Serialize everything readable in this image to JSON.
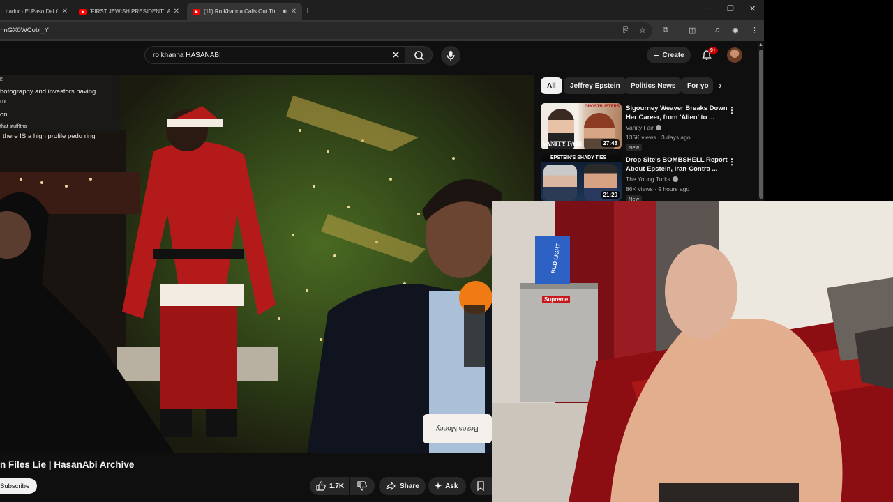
{
  "browser": {
    "tabs": [
      {
        "title": "nador - El Paso Del Gi"
      },
      {
        "title": "'FIRST JEWISH PRESIDENT': Ade"
      },
      {
        "title": "(11) Ro Khanna Calls Out Th",
        "active": true
      }
    ],
    "url": "=nGX0WCobl_Y"
  },
  "youtube": {
    "search_value": "ro khanna HASANABI",
    "create_label": "Create",
    "notification_count": "9+",
    "chips": [
      "All",
      "Jeffrey Epstein",
      "Politics News",
      "For yo"
    ],
    "recommendations": [
      {
        "title": "Sigourney Weaver Breaks Down Her Career, from 'Alien' to ...",
        "channel": "Vanity Fair",
        "meta": "135K views · 3 days ago",
        "badge": "New",
        "duration": "27:48",
        "thumb_top_text": "GHOSTBUSTERS",
        "thumb_bottom_text": "VANITY FAIR"
      },
      {
        "title": "Drop Site's BOMBSHELL Report About Epstein, Iran-Contra ...",
        "channel": "The Young Turks",
        "meta": "86K views · 9 hours ago",
        "badge": "New",
        "duration": "21:20",
        "thumb_top_text": "EPSTEIN'S SHADY TIES"
      }
    ],
    "video": {
      "title": "n Files Lie | HasanAbi Archive",
      "subscribe_label": "Subscribe",
      "likes": "1.7K",
      "share_label": "Share",
      "ask_label": "Ask",
      "sign_text": "Bezos Money",
      "chat_lines": [
        "l!",
        "hotography and investors having",
        "m",
        "on",
        "that stuff!tho",
        "there IS a high profile pedo ring"
      ]
    }
  },
  "webcam": {
    "can_text": "BUD LIGHT",
    "sticker_text": "Supreme"
  },
  "colors": {
    "youtube_red": "#ff0000",
    "background": "#0f0f0f",
    "chip_bg": "#272727"
  }
}
